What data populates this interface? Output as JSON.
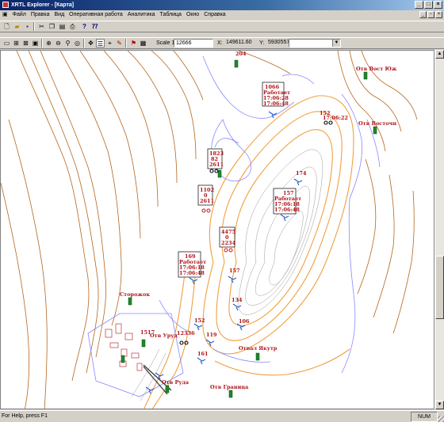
{
  "window": {
    "title": "XRTL Explorer - [Карта]"
  },
  "menu": [
    "Файл",
    "Правка",
    "Вид",
    "Оперативная работа",
    "Аналитика",
    "Таблица",
    "Окно",
    "Справка"
  ],
  "toolbar2": {
    "scale_label": "Scale 1:",
    "scale_value": "12666",
    "x_label": "X:",
    "x_value": "149611.60",
    "y_label": "Y:",
    "y_value": "5930557.6",
    "layer_select": ""
  },
  "map": {
    "labels": {
      "l1": "1066",
      "l2": "Работает",
      "l3": "17:06:28",
      "l4": "17:06:48",
      "l5": "1823",
      "l6": "82",
      "l7": "2611",
      "l8": "1102",
      "l9": "0",
      "l10": "2611",
      "l11": "157",
      "l12": "Работает",
      "l13": "17:06:18",
      "l14": "17:06:48",
      "l15": "4475",
      "l16": "0",
      "l17": "2234",
      "l18": "169",
      "l19": "Работает",
      "l20": "17:06:18",
      "l21": "17:06:48",
      "l22": "Отв Вост Юж",
      "l23": "Отв Восточн",
      "l24": "152",
      "l25": "17:06:22",
      "l26": "174",
      "l27": "157",
      "l28": "134",
      "l29": "106",
      "l30": "152",
      "l31": "12336",
      "l32": "119",
      "l33": "161",
      "l34": "Отвал Якутр",
      "l35": "Сторожок",
      "l36": "1517",
      "l37": "Отв Уруд",
      "l38": "Отв Граница",
      "l39": "Отв Руда",
      "l40": "204"
    }
  },
  "status": {
    "message": "For Help, press F1",
    "num": "NUM"
  },
  "colors": {
    "contour_outer": "#b5651d",
    "contour_pit": "#f0a040",
    "road": "#8888ff",
    "label": "#b0141a"
  }
}
